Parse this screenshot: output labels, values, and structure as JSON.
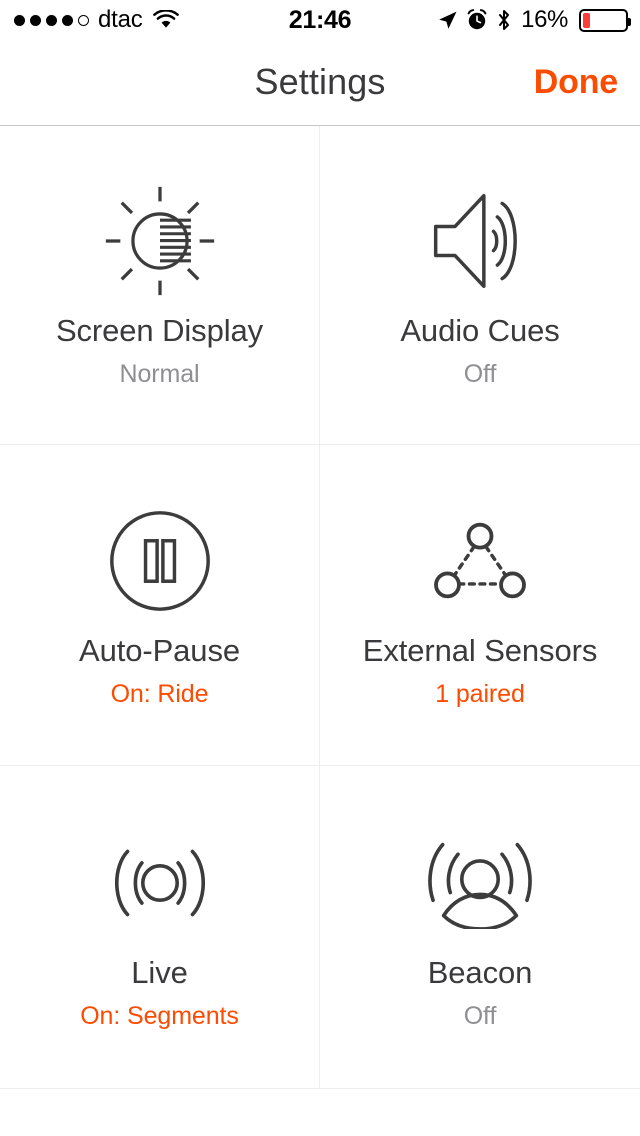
{
  "status_bar": {
    "signal_dots_filled": 4,
    "signal_dots_total": 5,
    "carrier": "dtac",
    "wifi_icon": "wifi-icon",
    "time": "21:46",
    "location_icon": "location-arrow-icon",
    "alarm_icon": "alarm-clock-icon",
    "bluetooth_icon": "bluetooth-icon",
    "battery_percent": "16%",
    "battery_level": 16,
    "battery_color": "#fc3d39"
  },
  "nav_bar": {
    "title": "Settings",
    "done_label": "Done",
    "done_color": "#fc4c02"
  },
  "colors": {
    "accent": "#fc4c02",
    "title": "#3a3a3c",
    "muted": "#8e8e93",
    "icon": "#3c3c3c",
    "divider": "#eeeeee",
    "nav_divider": "#c8c7cc"
  },
  "grid": {
    "rows": [
      [
        {
          "icon": "brightness-icon",
          "title": "Screen Display",
          "subtitle": "Normal",
          "subtitle_state": "off"
        },
        {
          "icon": "speaker-volume-icon",
          "title": "Audio Cues",
          "subtitle": "Off",
          "subtitle_state": "off"
        }
      ],
      [
        {
          "icon": "pause-circle-icon",
          "title": "Auto-Pause",
          "subtitle": "On: Ride",
          "subtitle_state": "on"
        },
        {
          "icon": "external-sensors-icon",
          "title": "External Sensors",
          "subtitle": "1 paired",
          "subtitle_state": "on"
        }
      ],
      [
        {
          "icon": "live-broadcast-icon",
          "title": "Live",
          "subtitle": "On: Segments",
          "subtitle_state": "on"
        },
        {
          "icon": "beacon-person-icon",
          "title": "Beacon",
          "subtitle": "Off",
          "subtitle_state": "off"
        }
      ]
    ]
  }
}
